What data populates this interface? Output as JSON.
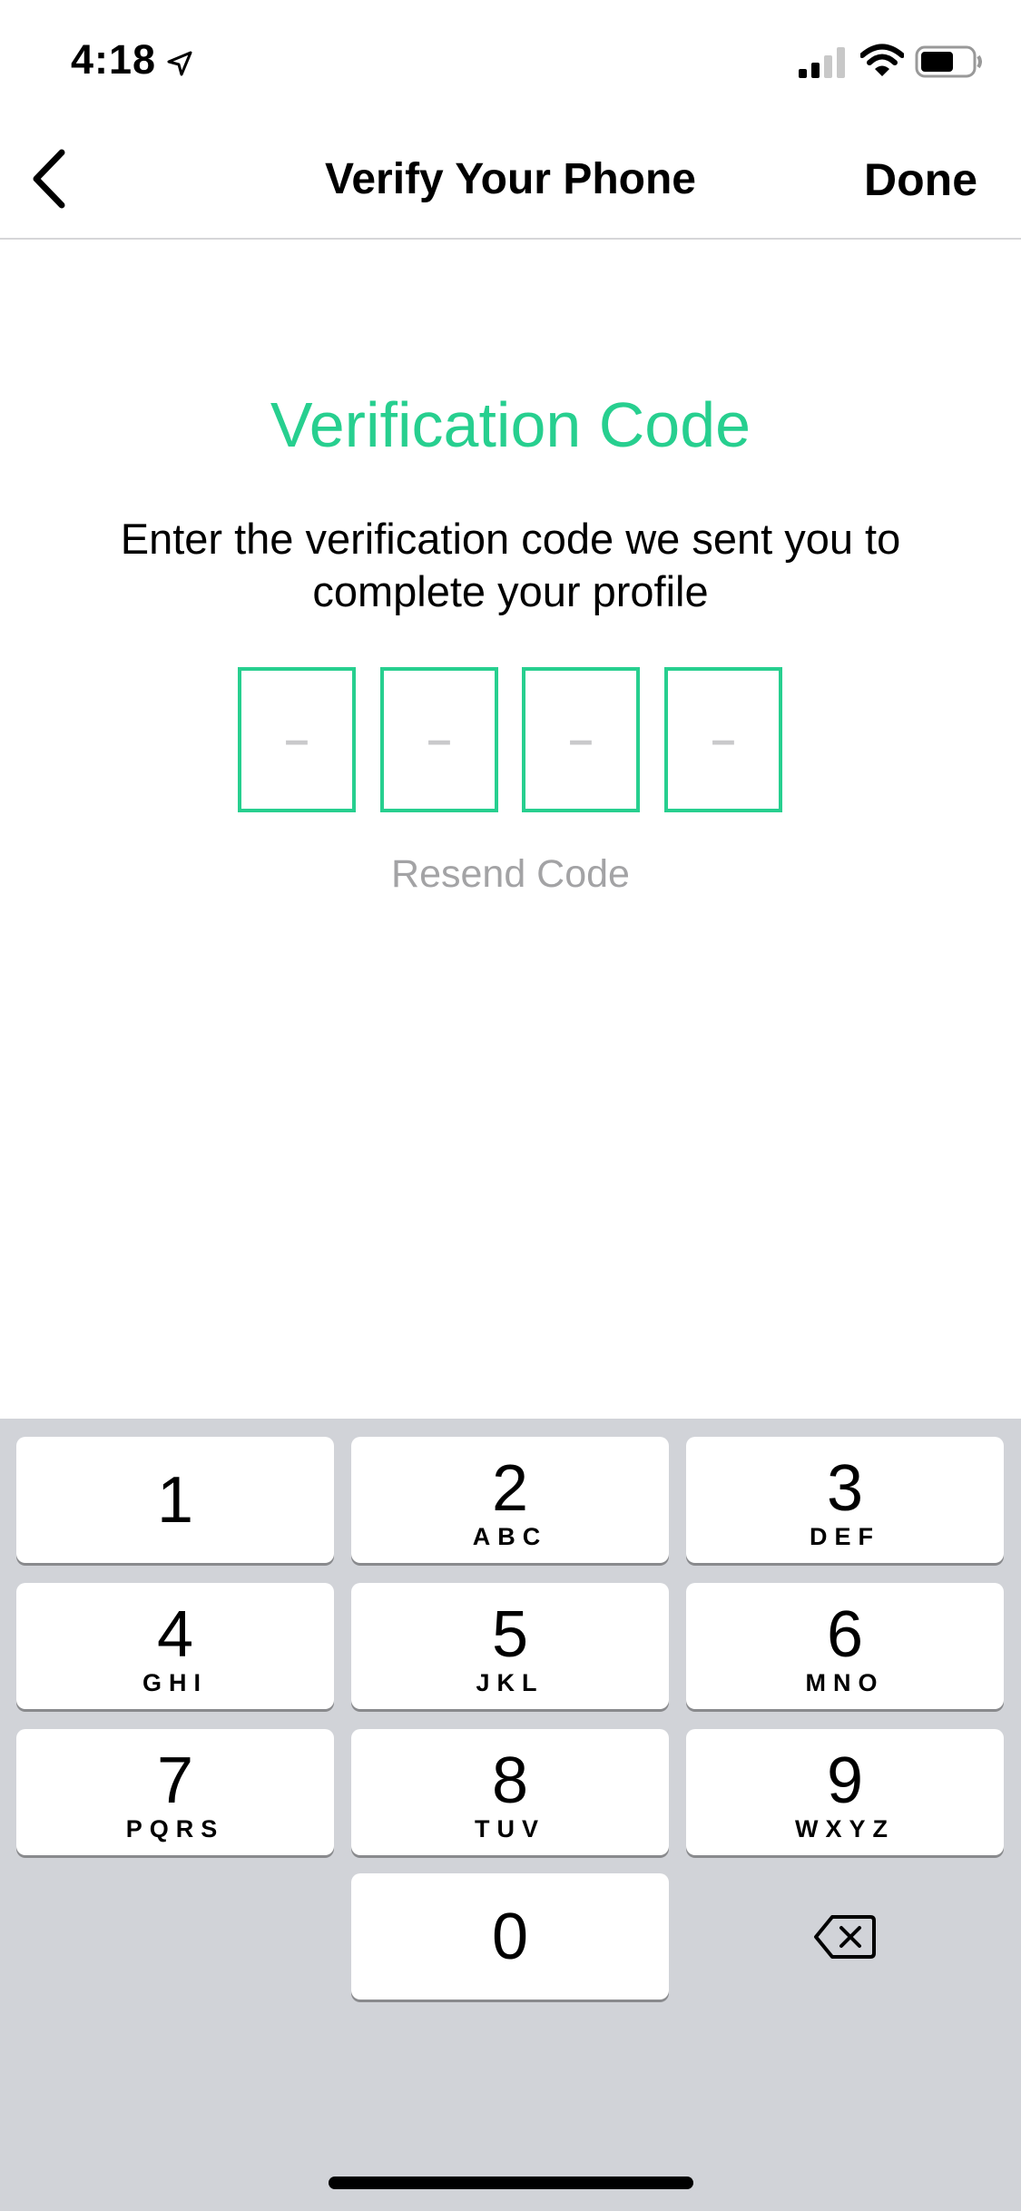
{
  "status_bar": {
    "time": "4:18",
    "location_icon": "location-arrow-icon",
    "signal_icon": "cellular-signal-icon",
    "wifi_icon": "wifi-icon",
    "battery_icon": "battery-icon",
    "battery_level": 0.65
  },
  "nav": {
    "back_icon": "chevron-left-icon",
    "title": "Verify Your Phone",
    "done_label": "Done"
  },
  "content": {
    "heading": "Verification Code",
    "instructions": "Enter the verification code we sent you to complete your profile",
    "code_placeholders": [
      "–",
      "–",
      "–",
      "–"
    ],
    "resend_label": "Resend Code"
  },
  "keypad": {
    "keys": [
      {
        "digit": "1",
        "letters": ""
      },
      {
        "digit": "2",
        "letters": "ABC"
      },
      {
        "digit": "3",
        "letters": "DEF"
      },
      {
        "digit": "4",
        "letters": "GHI"
      },
      {
        "digit": "5",
        "letters": "JKL"
      },
      {
        "digit": "6",
        "letters": "MNO"
      },
      {
        "digit": "7",
        "letters": "PQRS"
      },
      {
        "digit": "8",
        "letters": "TUV"
      },
      {
        "digit": "9",
        "letters": "WXYZ"
      },
      {
        "digit": "0",
        "letters": ""
      }
    ],
    "delete_icon": "backspace-icon"
  },
  "colors": {
    "accent": "#27cf8f",
    "secondary_text": "#a3a3a5",
    "placeholder": "#c9c9cb",
    "keypad_background": "#d1d3d8",
    "key_background": "#ffffff"
  }
}
